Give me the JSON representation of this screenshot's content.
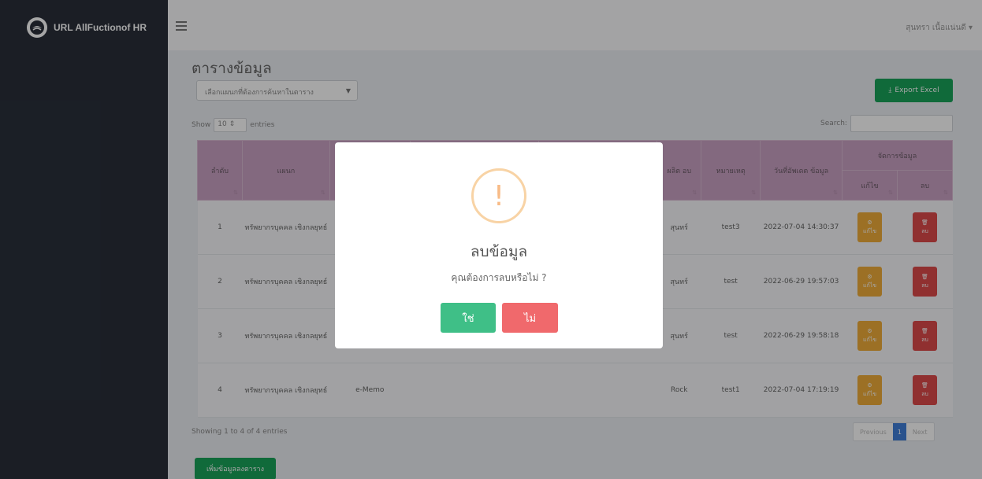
{
  "app": {
    "title": "URL AllFuctionof HR"
  },
  "user": {
    "name": "สุนทรา เนื้อแน่นดี ▾"
  },
  "page": {
    "title": "ตารางข้อมูล",
    "table_select": "เลือกแผนกที่ต้องการค้นหาในตาราง",
    "export_label": "Export Excel",
    "show_label": "Show",
    "entries_value": "10",
    "entries_label": "entries",
    "search_label": "Search:",
    "showing_info": "Showing 1 to 4 of 4 entries",
    "add_label": "เพิ่มข้อมูลลงตาราง"
  },
  "table": {
    "headers": [
      "ลำดับ",
      "แผนก",
      "",
      "",
      "",
      "ผลิต อบ",
      "หมายเหตุ",
      "วันที่อัพเดต ข้อมูล",
      "จัดการข้อมูล"
    ],
    "sub_headers": [
      "แก้ไข",
      "ลบ"
    ],
    "rows": [
      {
        "no": "1",
        "dept": "ทรัพยากรบุคคล เชิงกลยุทธ์",
        "c3": "",
        "c4": "",
        "c5": "",
        "c6": "สุนทร์",
        "note": "test3",
        "updated": "2022-07-04 14:30:37"
      },
      {
        "no": "2",
        "dept": "ทรัพยากรบุคคล เชิงกลยุทธ์",
        "c3": "",
        "c4": "",
        "c5": "",
        "c6": "สุนทร์",
        "note": "test",
        "updated": "2022-06-29 19:57:03"
      },
      {
        "no": "3",
        "dept": "ทรัพยากรบุคคล เชิงกลยุทธ์",
        "c3": "",
        "c4": "",
        "c5": "",
        "c6": "สุนทร์",
        "note": "test",
        "updated": "2022-06-29 19:58:18"
      },
      {
        "no": "4",
        "dept": "ทรัพยากรบุคคล เชิงกลยุทธ์",
        "c3": "e-Memo",
        "c4": "",
        "c5": "",
        "c6": "Rock",
        "note": "test1",
        "updated": "2022-07-04 17:19:19"
      }
    ],
    "edit_label": "แก้ไข",
    "delete_label": "ลบ"
  },
  "pagination": {
    "previous": "Previous",
    "current": "1",
    "next": "Next"
  },
  "modal": {
    "icon": "!",
    "title": "ลบข้อมูล",
    "text": "คุณต้องการลบหรือไม่ ?",
    "yes": "ใช่",
    "no": "ไม่"
  },
  "colors": {
    "sidebar": "#2a2f3a",
    "table_header": "#caa2c4",
    "green": "#1aa35a",
    "edit": "#f0ad3a",
    "delete": "#de4a4a",
    "confirm": "#3fbf87",
    "cancel": "#f0696c",
    "warning": "#f8bb86"
  }
}
